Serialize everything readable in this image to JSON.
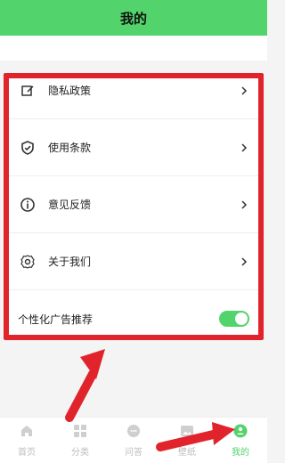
{
  "header": {
    "title": "我的"
  },
  "menu": {
    "items": [
      {
        "label": "隐私政策",
        "icon": "edit-icon"
      },
      {
        "label": "使用条款",
        "icon": "shield-check-icon"
      },
      {
        "label": "意见反馈",
        "icon": "info-icon"
      },
      {
        "label": "关于我们",
        "icon": "gear-icon"
      }
    ],
    "toggle": {
      "label": "个性化广告推荐",
      "state": "on",
      "accent": "#52d36b"
    }
  },
  "bottom_nav": {
    "items": [
      {
        "label": "首页",
        "icon": "home-icon"
      },
      {
        "label": "分类",
        "icon": "grid-icon"
      },
      {
        "label": "问答",
        "icon": "chat-icon"
      },
      {
        "label": "壁纸",
        "icon": "image-icon"
      },
      {
        "label": "我的",
        "icon": "profile-icon",
        "active": true
      }
    ]
  },
  "colors": {
    "primary": "#52d36b",
    "highlight": "#e1232b"
  }
}
